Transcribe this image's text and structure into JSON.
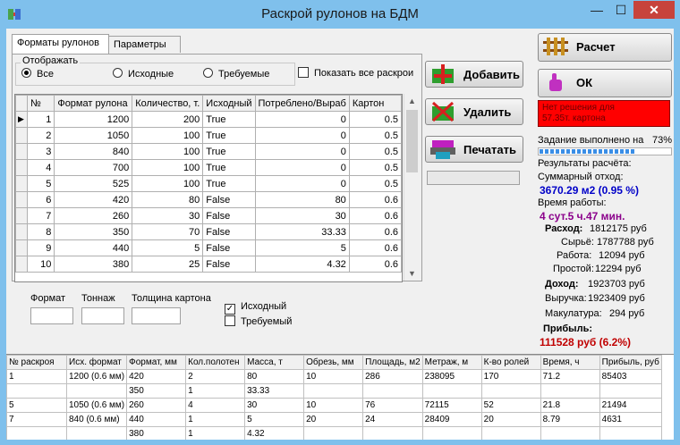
{
  "window": {
    "title": "Раскрой рулонов на БДМ",
    "minimize": "—",
    "maximize": "☐",
    "close": "✕"
  },
  "tabs": [
    {
      "label": "Форматы рулонов",
      "active": true
    },
    {
      "label": "Параметры",
      "active": false
    }
  ],
  "display_group": {
    "label": "Отображать",
    "options": [
      {
        "label": "Все",
        "selected": true
      },
      {
        "label": "Исходные",
        "selected": false
      },
      {
        "label": "Требуемые",
        "selected": false
      }
    ],
    "show_all_label": "Показать все раскрои",
    "show_all_checked": false
  },
  "grid": {
    "columns": [
      "№",
      "Формат рулона",
      "Количество, т.",
      "Исходный",
      "Потреблено/Выраб",
      "Картон"
    ],
    "rows": [
      [
        "1",
        "1200",
        "200",
        "True",
        "0",
        "0.5"
      ],
      [
        "2",
        "1050",
        "100",
        "True",
        "0",
        "0.5"
      ],
      [
        "3",
        "840",
        "100",
        "True",
        "0",
        "0.5"
      ],
      [
        "4",
        "700",
        "100",
        "True",
        "0",
        "0.5"
      ],
      [
        "5",
        "525",
        "100",
        "True",
        "0",
        "0.5"
      ],
      [
        "6",
        "420",
        "80",
        "False",
        "80",
        "0.6"
      ],
      [
        "7",
        "260",
        "30",
        "False",
        "30",
        "0.6"
      ],
      [
        "8",
        "350",
        "70",
        "False",
        "33.33",
        "0.6"
      ],
      [
        "9",
        "440",
        "5",
        "False",
        "5",
        "0.6"
      ],
      [
        "10",
        "380",
        "25",
        "False",
        "4.32",
        "0.6"
      ]
    ],
    "current_row_marker": "▶"
  },
  "fields": {
    "format_label": "Формат",
    "tonnage_label": "Тоннаж",
    "thickness_label": "Толщина картона",
    "format_value": "",
    "tonnage_value": "",
    "thickness_value": ""
  },
  "checks": {
    "source_label": "Исходный",
    "source_checked": true,
    "source_mark": "✓",
    "required_label": "Требуемый",
    "required_checked": false
  },
  "buttons": {
    "add": "Добавить",
    "delete": "Удалить",
    "print": "Печатать",
    "calc": "Расчет",
    "ok": "ОК"
  },
  "status": {
    "no_solution_line1": "Нет решения для",
    "no_solution_line2": "57.35т. картона",
    "task_done_label": "Задание выполнено на",
    "task_done_pct": "73%",
    "task_done_fraction": 0.73
  },
  "results": {
    "header": "Результаты расчёта:",
    "waste_label": "Суммарный отход:",
    "waste_value": "3670.29 м2 (0.95 %)",
    "time_label": "Время работы:",
    "time_value": "4 сут.5 ч.47 мин.",
    "expense_label": "Расход:",
    "expense_value": "1812175 руб",
    "raw_label": "Сырьё:",
    "raw_value": "1787788 руб",
    "work_label": "Работа:",
    "work_value": "12094 руб",
    "idle_label": "Простой:",
    "idle_value": "12294 руб",
    "income_label": "Доход:",
    "income_value": "1923703 руб",
    "revenue_label": "Выручка:",
    "revenue_value": "1923409 руб",
    "waste_paper_label": "Макулатура:",
    "waste_paper_value": "294 руб",
    "profit_label": "Прибыль:",
    "profit_value": "111528 руб (6.2%)"
  },
  "bottom_grid": {
    "columns": [
      "№ раскроя",
      "Исх. формат",
      "Формат, мм",
      "Кол.полотен",
      "Масса, т",
      "Обрезь, мм",
      "Площадь, м2",
      "Метраж, м",
      "К-во ролей",
      "Время, ч",
      "Прибыль, руб"
    ],
    "rows": [
      [
        "1",
        "1200 (0.6 мм)",
        "420",
        "2",
        "80",
        "10",
        "286",
        "238095",
        "170",
        "71.2",
        "85403"
      ],
      [
        "",
        "",
        "350",
        "1",
        "33.33",
        "",
        "",
        "",
        "",
        "",
        ""
      ],
      [
        "5",
        "1050 (0.6 мм)",
        "260",
        "4",
        "30",
        "10",
        "76",
        "72115",
        "52",
        "21.8",
        "21494"
      ],
      [
        "7",
        "840 (0.6 мм)",
        "440",
        "1",
        "5",
        "20",
        "24",
        "28409",
        "20",
        "8.79",
        "4631"
      ],
      [
        "",
        "",
        "380",
        "1",
        "4.32",
        "",
        "",
        "",
        "",
        "",
        ""
      ]
    ]
  }
}
